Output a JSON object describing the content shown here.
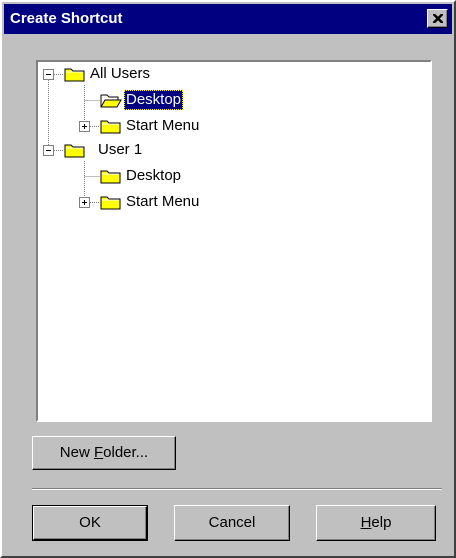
{
  "window": {
    "title": "Create Shortcut",
    "close_icon": "close-icon"
  },
  "tree": {
    "nodes": [
      {
        "label": "All Users",
        "level": 0,
        "expander": "minus",
        "folder": "closed",
        "selected": false
      },
      {
        "label": "Desktop",
        "level": 1,
        "expander": "none",
        "folder": "open",
        "selected": true
      },
      {
        "label": "Start Menu",
        "level": 1,
        "expander": "plus",
        "folder": "closed",
        "selected": false
      },
      {
        "label": "User 1",
        "level": 0,
        "expander": "minus",
        "folder": "closed",
        "selected": false
      },
      {
        "label": "Desktop",
        "level": 1,
        "expander": "none",
        "folder": "closed",
        "selected": false
      },
      {
        "label": "Start Menu",
        "level": 1,
        "expander": "plus",
        "folder": "closed",
        "selected": false
      }
    ]
  },
  "buttons": {
    "new_folder": {
      "before": "New ",
      "mnemonic": "F",
      "after": "older..."
    },
    "ok": "OK",
    "cancel": "Cancel",
    "help": {
      "before": "",
      "mnemonic": "H",
      "after": "elp"
    }
  },
  "colors": {
    "titlebar": "#000080",
    "face": "#c0c0c0",
    "folder": "#ffff00",
    "selection": "#000080"
  }
}
